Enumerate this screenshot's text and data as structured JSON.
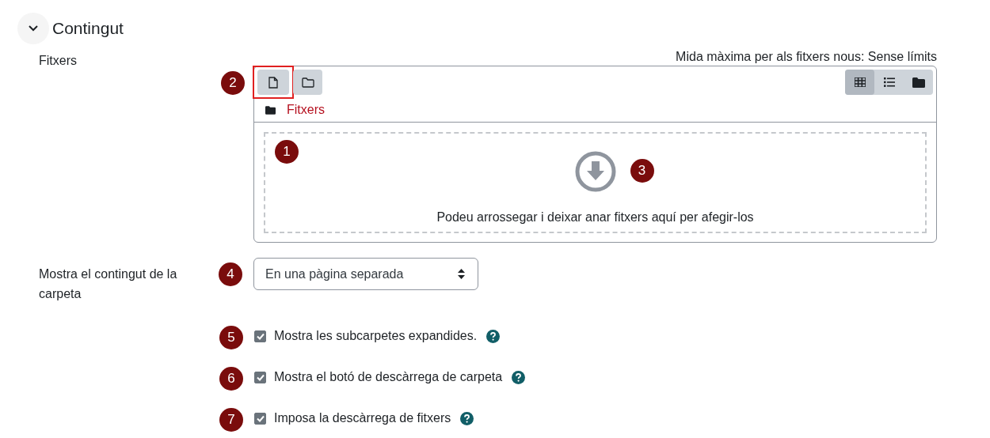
{
  "section": {
    "title": "Contingut",
    "expanded": true
  },
  "files": {
    "label": "Fitxers",
    "max_size": "Mida màxima per als fitxers nous: Sense límits",
    "actions": [
      {
        "kind": "add-file",
        "highlighted": true,
        "marker": "2"
      },
      {
        "kind": "add-folder",
        "highlighted": false
      }
    ],
    "views": [
      {
        "kind": "grid",
        "selected": true
      },
      {
        "kind": "list",
        "selected": false
      },
      {
        "kind": "tree",
        "selected": false
      }
    ],
    "path": "Fitxers",
    "dropzone": {
      "text": "Podeu arrossegar i deixar anar fitxers aquí per afegir-los",
      "marker": "1",
      "icon_marker": "3"
    }
  },
  "display": {
    "label": "Mostra el contingut de la carpeta",
    "value": "En una pàgina separada",
    "marker": "4"
  },
  "options": [
    {
      "label": "Mostra les subcarpetes expandides.",
      "checked": true,
      "marker": "5"
    },
    {
      "label": "Mostra el botó de descàrrega de carpeta",
      "checked": true,
      "marker": "6"
    },
    {
      "label": "Imposa la descàrrega de fitxers",
      "checked": true,
      "marker": "7"
    }
  ]
}
